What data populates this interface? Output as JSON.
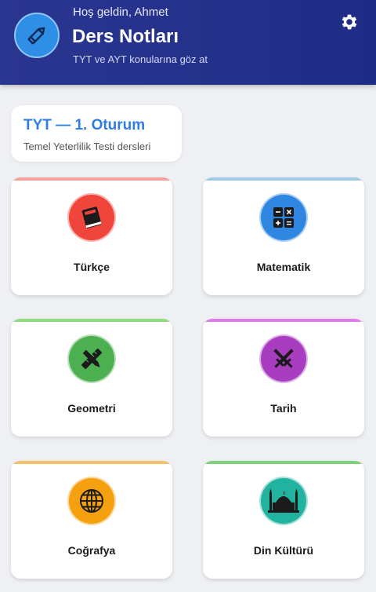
{
  "header": {
    "greeting": "Hoş geldin, Ahmet",
    "title": "Ders Notları",
    "subtitle": "TYT ve AYT konularına göz at",
    "logo_icon": "pencil-icon",
    "settings_icon": "gear-icon",
    "bg_color": "#23318a"
  },
  "section": {
    "title": "TYT — 1. Oturum",
    "description": "Temel Yeterlilik Testi dersleri"
  },
  "subjects": [
    {
      "label": "Türkçe",
      "icon": "book-icon",
      "color": "#f0453a",
      "accent": "#f3a29b"
    },
    {
      "label": "Matematik",
      "icon": "calculator-icon",
      "color": "#2f86e0",
      "accent": "#9fcbe6"
    },
    {
      "label": "Geometri",
      "icon": "ruler-pencil-icon",
      "color": "#4caf50",
      "accent": "#8fdc7e"
    },
    {
      "label": "Tarih",
      "icon": "crossed-swords-icon",
      "color": "#a83dc0",
      "accent": "#e07ce8"
    },
    {
      "label": "Coğrafya",
      "icon": "globe-icon",
      "color": "#f5a00f",
      "accent": "#f2c36b"
    },
    {
      "label": "Din Kültürü",
      "icon": "mosque-icon",
      "color": "#22b3a0",
      "accent": "#7fd07a"
    }
  ]
}
